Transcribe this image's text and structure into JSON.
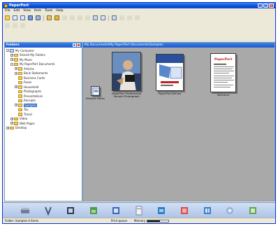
{
  "window": {
    "title": "PaperPort",
    "controls": {
      "minimize": "_",
      "maximize": "□",
      "close": "x"
    }
  },
  "menu": [
    "File",
    "Edit",
    "View",
    "Item",
    "Tools",
    "Help"
  ],
  "folder_pane": {
    "title": "Folders",
    "tree": [
      {
        "label": "My Computer",
        "level": 0,
        "exp": "-",
        "icon": "comp"
      },
      {
        "label": "Shared My Folders",
        "level": 1,
        "exp": "+",
        "icon": "folder"
      },
      {
        "label": "My Music",
        "level": 1,
        "exp": "+",
        "icon": "folder"
      },
      {
        "label": "My PaperPort Documents",
        "level": 1,
        "exp": "-",
        "icon": "folder"
      },
      {
        "label": "Articles",
        "level": 2,
        "exp": "+",
        "icon": "folder"
      },
      {
        "label": "Bank Statements",
        "level": 2,
        "exp": "+",
        "icon": "folder"
      },
      {
        "label": "Business Cards",
        "level": 2,
        "exp": "",
        "icon": "folder"
      },
      {
        "label": "Faxes",
        "level": 2,
        "exp": "",
        "icon": "folder"
      },
      {
        "label": "Household",
        "level": 2,
        "exp": "+",
        "icon": "folder"
      },
      {
        "label": "Photographs",
        "level": 2,
        "exp": "",
        "icon": "folder"
      },
      {
        "label": "Presentations",
        "level": 2,
        "exp": "",
        "icon": "folder"
      },
      {
        "label": "Receipts",
        "level": 2,
        "exp": "",
        "icon": "folder"
      },
      {
        "label": "Samples",
        "level": 2,
        "exp": "+",
        "icon": "folder",
        "selected": true
      },
      {
        "label": "Tax",
        "level": 2,
        "exp": "",
        "icon": "folder"
      },
      {
        "label": "Travel",
        "level": 2,
        "exp": "",
        "icon": "folder"
      },
      {
        "label": "Video",
        "level": 1,
        "exp": "+",
        "icon": "folder"
      },
      {
        "label": "Web Pages",
        "level": 1,
        "exp": "+",
        "icon": "folder"
      },
      {
        "label": "Desktop",
        "level": 0,
        "exp": "+",
        "icon": "folder"
      }
    ]
  },
  "doc_pane": {
    "path": "My Documents\\My PaperPort Documents\\Samples",
    "items": [
      {
        "caption_line1": "Release Notes",
        "caption_line2": ""
      },
      {
        "caption_line1": "PaperPort Professional",
        "caption_line2": "Sample Photograph"
      },
      {
        "caption_line1": "PaperPort Deluxe",
        "caption_line2": ""
      },
      {
        "caption_line1": "Welcome",
        "caption_line2": ""
      }
    ],
    "logo_text": "PaperPort"
  },
  "statusbar": {
    "left": "Folder: Samples  4 items",
    "mid": "Print queue",
    "memory_label": "Memory",
    "memory_level": 0.6
  },
  "colors": {
    "titlebar": "#0a4fd6",
    "doc_area_bg": "#a9a9a9",
    "selection": "#316ac5"
  },
  "icons": {
    "toolbar1": [
      "new-folder-icon",
      "open-icon",
      "copy-icon",
      "scan-icon",
      "cut-icon",
      "paste-icon",
      "undo-icon",
      "redo-icon",
      "stack-icon",
      "unstack-icon",
      "rotate-icon",
      "page-view-icon",
      "zoom-icon",
      "find-icon",
      "profile-icon",
      "print-icon",
      "send-icon"
    ],
    "toolbar2": [
      "thumbnail-size-icon",
      "sort-icon",
      "filter-icon"
    ],
    "bottombar": [
      "scanner-icon",
      "paperport-sendto-icon",
      "ocr-icon",
      "photo-editor-icon",
      "image-editor-icon",
      "form-icon",
      "word-icon",
      "pdf-icon",
      "excel-icon",
      "email-icon",
      "web-icon"
    ]
  }
}
